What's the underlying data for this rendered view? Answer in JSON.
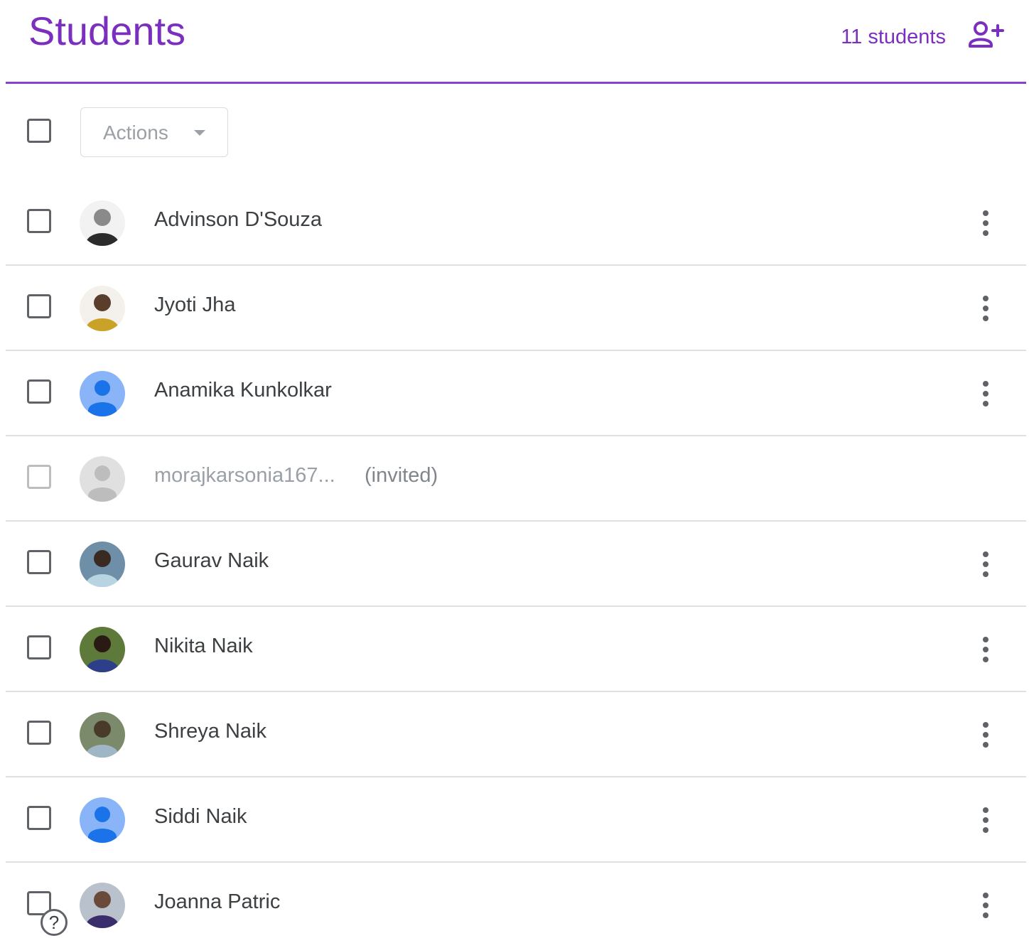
{
  "header": {
    "title": "Students",
    "count_label": "11 students",
    "add_icon": "person-add-icon"
  },
  "toolbar": {
    "actions_label": "Actions",
    "caret_icon": "dropdown-caret-icon"
  },
  "colors": {
    "accent": "#7b2fbe",
    "default_avatar_bg": "#8ab4f8",
    "default_avatar_fg": "#1a73e8",
    "text": "#3c4043",
    "muted": "#9aa0a6"
  },
  "students": [
    {
      "name": "Advinson D'Souza",
      "avatar": "photo"
    },
    {
      "name": "Jyoti Jha",
      "avatar": "photo"
    },
    {
      "name": "Anamika Kunkolkar",
      "avatar": "default"
    },
    {
      "name": "morajkarsonia167...",
      "avatar": "default-gray",
      "status": "(invited)"
    },
    {
      "name": "Gaurav Naik",
      "avatar": "photo"
    },
    {
      "name": "Nikita Naik",
      "avatar": "photo"
    },
    {
      "name": "Shreya Naik",
      "avatar": "photo"
    },
    {
      "name": "Siddi Naik",
      "avatar": "default"
    },
    {
      "name": "Joanna Patric",
      "avatar": "photo"
    }
  ],
  "footer": {
    "help_glyph": "?",
    "help_icon": "help-icon"
  }
}
